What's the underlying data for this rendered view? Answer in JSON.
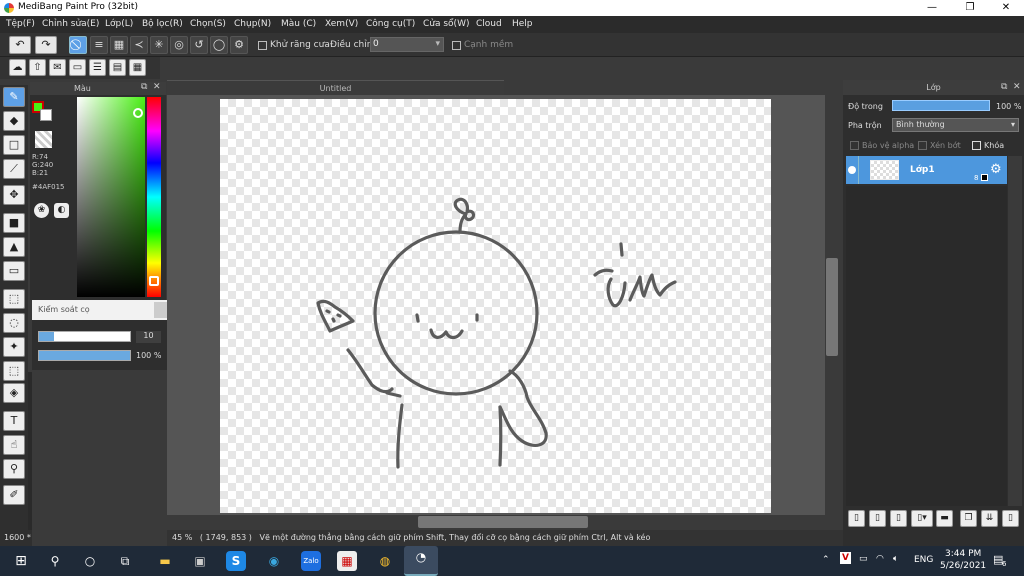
{
  "window": {
    "title": "MediBang Paint Pro (32bit)",
    "minimize": "—",
    "maximize": "❐",
    "close": "✕"
  },
  "menu": [
    "Tệp(F)",
    "Chỉnh sửa(E)",
    "Lớp(L)",
    "Bộ lọc(R)",
    "Chọn(S)",
    "Chụp(N)",
    "Màu (C)",
    "Xem(V)",
    "Công cụ(T)",
    "Cửa sổ(W)",
    "Cloud",
    "Help"
  ],
  "toolbar": {
    "antialias_label": "Khử răng cưa",
    "adjust_label": "Điều chỉnh",
    "adjust_value": "0",
    "smooth_label": "Cạnh mềm"
  },
  "color_panel": {
    "title": "Màu",
    "r": "R:74",
    "g": "G:240",
    "b": "B:21",
    "hex": "#4AF015",
    "main_color": "#4af015"
  },
  "brush_panel": {
    "title": "Kiểm soát cọ",
    "size_value": "10",
    "size_fraction": 0.17,
    "opacity_value": "100 %",
    "opacity_fraction": 1.0
  },
  "document": {
    "tab_title": "Untitled",
    "handwriting": "ủm"
  },
  "status": {
    "zoom": "45 %",
    "coords": "( 1749, 853 )",
    "hint": "Vẽ một đường thẳng bằng cách giữ phím Shift, Thay đổi cỡ cọ bằng cách giữ phím Ctrl, Alt và kéo",
    "left_zoom": "1600 *"
  },
  "layer_panel": {
    "title": "Lớp",
    "opacity_label": "Độ trong",
    "opacity_value": "100 %",
    "opacity_fraction": 1.0,
    "blend_label": "Pha trộn",
    "blend_value": "Bình thường",
    "protect_alpha": "Bảo vệ alpha",
    "clipping": "Xén bớt",
    "lock": "Khóa",
    "layer_name": "Lớp1",
    "layer_number": "8"
  },
  "taskbar": {
    "language": "ENG",
    "time": "3:44 PM",
    "date": "5/26/2021",
    "notification_count": "6"
  }
}
